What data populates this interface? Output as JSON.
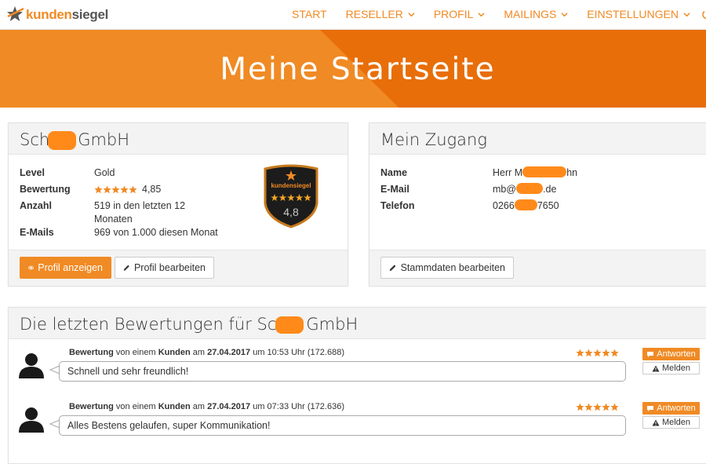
{
  "brand": {
    "name_a": "kunden",
    "name_b": "siegel"
  },
  "colors": {
    "accent": "#f08a24",
    "accent_dark": "#e86e09",
    "redaction": "#ff8a1a"
  },
  "nav": {
    "items": [
      {
        "label": "START",
        "dropdown": false
      },
      {
        "label": "RESELLER",
        "dropdown": true
      },
      {
        "label": "PROFIL",
        "dropdown": true
      },
      {
        "label": "MAILINGS",
        "dropdown": true
      },
      {
        "label": "EINSTELLUNGEN",
        "dropdown": true
      }
    ]
  },
  "hero": {
    "title": "Meine Startseite"
  },
  "company": {
    "name_prefix": "Sch",
    "name_suffix": "GmbH",
    "level_label": "Level",
    "level_value": "Gold",
    "rating_label": "Bewertung",
    "rating_value": "4,85",
    "rating_stars": 5,
    "count_label": "Anzahl",
    "count_value_line1": "519 in den letzten 12",
    "count_value_line2": "Monaten",
    "emails_label": "E-Mails",
    "emails_value": "969 von 1.000 diesen Monat",
    "badge_brand": "kundensiegel",
    "badge_score": "4,8",
    "btn_view": "Profil anzeigen",
    "btn_edit": "Profil bearbeiten"
  },
  "access": {
    "title": "Mein Zugang",
    "name_label": "Name",
    "name_prefix": "Herr M",
    "name_suffix": "hn",
    "email_label": "E-Mail",
    "email_prefix": "mb@",
    "email_suffix": ".de",
    "phone_label": "Telefon",
    "phone_prefix": "0266",
    "phone_suffix": "7650",
    "btn_edit": "Stammdaten bearbeiten"
  },
  "reviews_section": {
    "title_prefix": "Die letzten Bewertungen für Sc",
    "title_suffix": "GmbH",
    "reviews": [
      {
        "meta_a": "Bewertung",
        "meta_b": " von einem ",
        "meta_c": "Kunden",
        "meta_d": " am ",
        "meta_date": "27.04.2017",
        "meta_e": " um 10:53 Uhr (172.688)",
        "text": "Schnell und sehr freundlich!",
        "stars": 5,
        "btn_reply": "Antworten",
        "btn_report": "Melden"
      },
      {
        "meta_a": "Bewertung",
        "meta_b": " von einem ",
        "meta_c": "Kunden",
        "meta_d": " am ",
        "meta_date": "27.04.2017",
        "meta_e": " um 07:33 Uhr (172.636)",
        "text": "Alles Bestens gelaufen, super Kommunikation!",
        "stars": 5,
        "btn_reply": "Antworten",
        "btn_report": "Melden"
      }
    ]
  },
  "icons": {
    "logo": "star-swoosh-icon",
    "dropdown": "chevron-down-icon",
    "view": "eye-icon",
    "edit": "pencil-icon",
    "reply": "comment-icon",
    "report": "warning-icon",
    "avatar": "user-silhouette-icon",
    "rating": "star-icon"
  }
}
